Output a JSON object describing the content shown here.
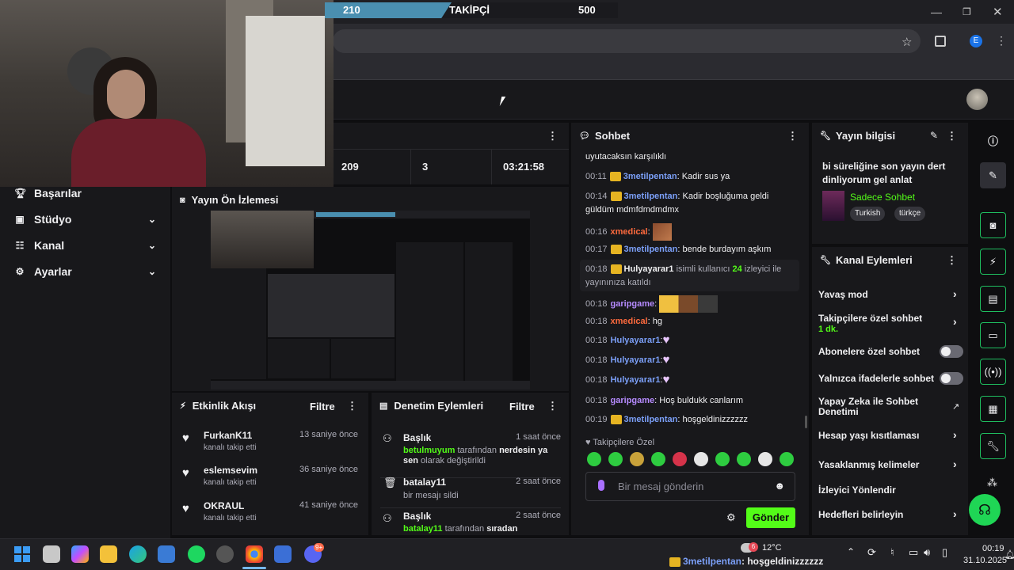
{
  "follow_goal": {
    "current": "210",
    "label": "TAKİPÇİ",
    "target": "500",
    "progress": 0.42
  },
  "nav": {
    "items": [
      {
        "label": "Başarılar",
        "icon": "trophy-icon"
      },
      {
        "label": "Stüdyo",
        "icon": "studio-icon"
      },
      {
        "label": "Kanal",
        "icon": "channel-icon"
      },
      {
        "label": "Ayarlar",
        "icon": "gear-icon"
      }
    ]
  },
  "stats": {
    "viewers": "209",
    "chatters": "3",
    "uptime": "03:21:58"
  },
  "preview": {
    "title": "Yayın Ön İzlemesi"
  },
  "activity": {
    "title": "Etkinlik Akışı",
    "filter": "Filtre",
    "events": [
      {
        "name": "FurkanK11",
        "action": "kanalı takip etti",
        "time": "13 saniye önce"
      },
      {
        "name": "eslemsevim",
        "action": "kanalı takip etti",
        "time": "36 saniye önce"
      },
      {
        "name": "OKRAUL",
        "action": "kanalı takip etti",
        "time": "41 saniye önce"
      }
    ]
  },
  "moderation": {
    "title": "Denetim Eylemleri",
    "filter": "Filtre",
    "actions": [
      {
        "title": "Başlık",
        "time": "1 saat önce",
        "user": "betulmuyum",
        "mid": " tarafından ",
        "bold": "nerdesin ya sen",
        "rest": " olarak değiştirildi"
      },
      {
        "title": "batalay11",
        "time": "2 saat önce",
        "detail": "bir mesajı sildi"
      },
      {
        "title": "Başlık",
        "time": "2 saat önce",
        "user": "batalay11",
        "mid": " tarafından ",
        "bold": "sıradan yayıncının",
        "rest": ""
      }
    ]
  },
  "chat": {
    "title": "Sohbet",
    "lines": [
      {
        "time": "",
        "user": "",
        "text": "uyutacaksın karşılıklı"
      },
      {
        "time": "00:11",
        "user": "3metilpentan",
        "text": ": Kadir sus ya"
      },
      {
        "time": "00:14",
        "user": "3metilpentan",
        "text": ": Kadir boşluğuma geldi güldüm mdmfdmdmdmx"
      },
      {
        "time": "00:16",
        "user": "xmedical",
        "text": ":"
      },
      {
        "time": "00:17",
        "user": "3metilpentan",
        "text": ": bende burdayım aşkım"
      },
      {
        "time": "00:18",
        "user": "Hulyayarar1",
        "text": " isimli kullanıcı ",
        "count": "24",
        "rest": " izleyici ile yayınınıza katıldı"
      },
      {
        "time": "00:18",
        "user": "garipgame",
        "text": ":"
      },
      {
        "time": "00:18",
        "user": "xmedical",
        "text": ": hg"
      },
      {
        "time": "00:18",
        "user": "Hulyayarar1",
        "text": ":"
      },
      {
        "time": "00:18",
        "user": "Hulyayarar1",
        "text": ":"
      },
      {
        "time": "00:18",
        "user": "Hulyayarar1",
        "text": ":"
      },
      {
        "time": "00:18",
        "user": "garipgame",
        "text": ": Hoş buldukk canlarım"
      },
      {
        "time": "00:19",
        "user": "3metilpentan",
        "text": ": hoşgeldinizzzzzz"
      }
    ],
    "followers_only": "Takipçilere Özel",
    "placeholder": "Bir mesaj gönderin",
    "send": "Gönder",
    "overlay_user": "3metilpentan",
    "overlay_text": ": hoşgeldinizzzzzz"
  },
  "stream_info": {
    "title": "Yayın bilgisi",
    "stream_title": "bi süreliğine son yayın dert dinliyorum gel anlat",
    "category": "Sadece Sohbet",
    "tags": [
      "Turkish",
      "türkçe"
    ]
  },
  "channel_actions": {
    "title": "Kanal Eylemleri",
    "items": [
      {
        "label": "Yavaş mod",
        "type": "chevron"
      },
      {
        "label": "Takipçilere özel sohbet",
        "sub": "1 dk.",
        "type": "chevron"
      },
      {
        "label": "Abonelere özel sohbet",
        "type": "toggle"
      },
      {
        "label": "Yalnızca ifadelerle sohbet",
        "type": "toggle"
      },
      {
        "label": "Yapay Zeka ile Sohbet Denetimi",
        "type": "external"
      },
      {
        "label": "Hesap yaşı kısıtlaması",
        "type": "chevron"
      },
      {
        "label": "Yasaklanmış kelimeler",
        "type": "chevron"
      },
      {
        "label": "İzleyici Yönlendir",
        "type": "none"
      },
      {
        "label": "Hedefleri belirleyin",
        "type": "chevron"
      }
    ]
  },
  "taskbar": {
    "weather": "12°C",
    "weather_badge": "6",
    "discord_badge": "9+",
    "time": "00:19",
    "date": "31.10.2025"
  },
  "colors": {
    "accent_green": "#53fc18",
    "chat_blue": "#7b9ff7",
    "bg": "#0e0e10",
    "panel": "#18181b"
  }
}
